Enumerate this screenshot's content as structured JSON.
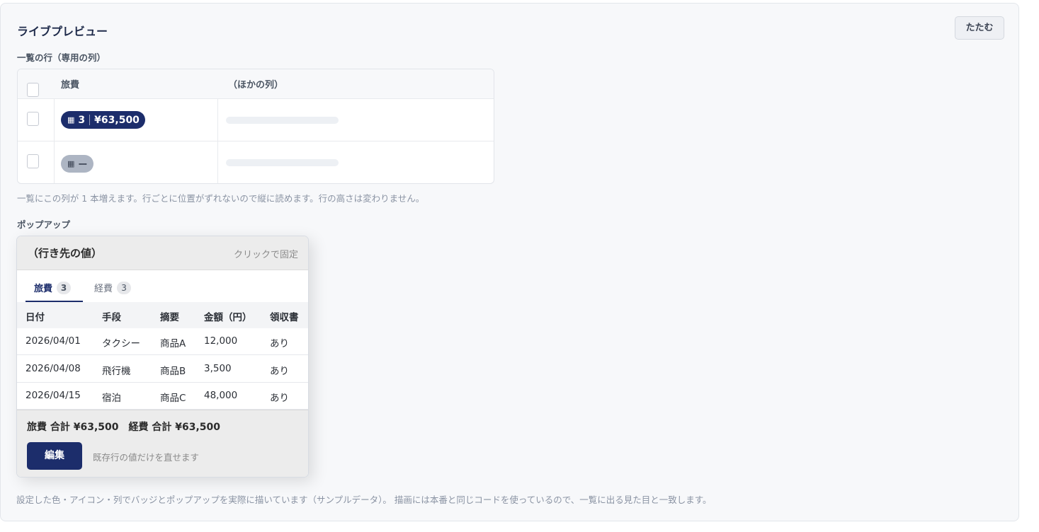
{
  "panel": {
    "title": "ライブプレビュー",
    "collapse_label": "たたむ"
  },
  "list_preview": {
    "section_label": "一覧の行（専用の列）",
    "columns": [
      "旅費",
      "（ほかの列）"
    ],
    "rows": [
      {
        "badge_icon": "table-icon",
        "count": "3",
        "amount": "¥63,500",
        "state": "active"
      },
      {
        "badge_icon": "table-icon",
        "count": "",
        "amount": "ー",
        "state": "empty"
      }
    ],
    "note": "一覧にこの列が 1 本増えます。行ごとに位置がずれないので縦に読めます。行の高さは変わりません。"
  },
  "popup_preview": {
    "section_label": "ポップアップ",
    "title": "（行き先の値）",
    "pin_hint": "クリックで固定",
    "tabs": [
      {
        "label": "旅費",
        "count": "3",
        "active": true
      },
      {
        "label": "経費",
        "count": "3",
        "active": false
      }
    ],
    "table": {
      "headers": [
        "日付",
        "手段",
        "摘要",
        "金額（円）",
        "領収書"
      ],
      "rows": [
        [
          "2026/04/01",
          "タクシー",
          "商品A",
          "12,000",
          "あり"
        ],
        [
          "2026/04/08",
          "飛行機",
          "商品B",
          "3,500",
          "あり"
        ],
        [
          "2026/04/15",
          "宿泊",
          "商品C",
          "48,000",
          "あり"
        ]
      ]
    },
    "totals": "旅費 合計 ¥63,500　経費 合計 ¥63,500",
    "edit_label": "編集",
    "edit_note": "既存行の値だけを直せます"
  },
  "footer_note": "設定した色・アイコン・列でバッジとポップアップを実際に描いています（サンプルデータ）。 描画には本番と同じコードを使っているので、一覧に出る見た目と一致します。",
  "colors": {
    "accent": "#1c2d6b",
    "badge_empty": "#adb5c3",
    "panel_bg": "#f7f8fa"
  }
}
